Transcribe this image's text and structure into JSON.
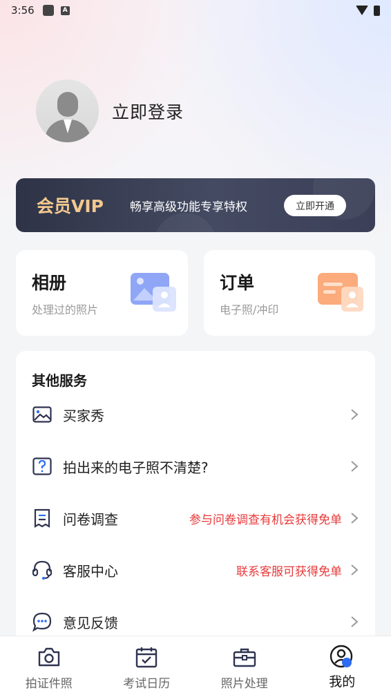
{
  "status_bar": {
    "time": "3:56",
    "a_badge": "A"
  },
  "profile": {
    "login_label": "立即登录"
  },
  "vip": {
    "title": "会员VIP",
    "description": "畅享高级功能专享特权",
    "button_label": "立即开通",
    "title_color": "#f3c98e"
  },
  "cards": {
    "album": {
      "title": "相册",
      "subtitle": "处理过的照片"
    },
    "order": {
      "title": "订单",
      "subtitle": "电子照/冲印"
    }
  },
  "services": {
    "title": "其他服务",
    "items": [
      {
        "label": "买家秀",
        "note": "",
        "icon": "image-icon"
      },
      {
        "label": "拍出来的电子照不清楚?",
        "note": "",
        "icon": "question-icon"
      },
      {
        "label": "问卷调查",
        "note": "参与问卷调查有机会获得免单",
        "icon": "survey-icon"
      },
      {
        "label": "客服中心",
        "note": "联系客服可获得免单",
        "icon": "headset-icon"
      },
      {
        "label": "意见反馈",
        "note": "",
        "icon": "feedback-icon"
      }
    ],
    "note_color": "#e8393a"
  },
  "tabbar": {
    "tabs": [
      {
        "label": "拍证件照",
        "icon": "camera-icon",
        "active": false
      },
      {
        "label": "考试日历",
        "icon": "calendar-icon",
        "active": false
      },
      {
        "label": "照片处理",
        "icon": "toolbox-icon",
        "active": false
      },
      {
        "label": "我的",
        "icon": "profile-icon",
        "active": true
      }
    ],
    "active_color": "#2d6cf0"
  }
}
